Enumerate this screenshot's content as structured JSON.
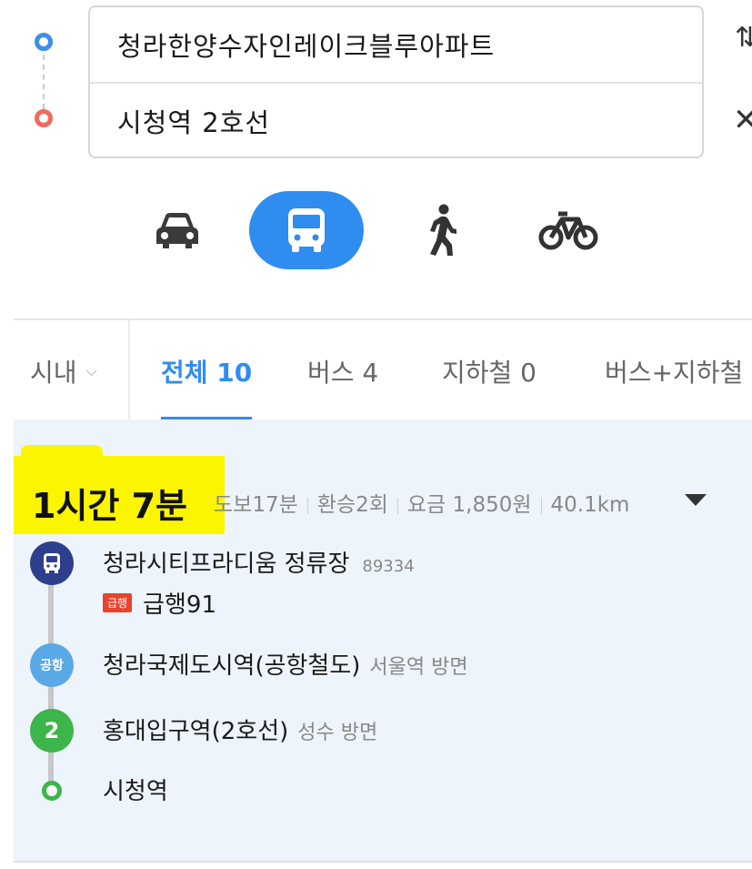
{
  "route": {
    "origin": "청라한양수자인레이크블루아파트",
    "destination": "시청역 2호선"
  },
  "modes": [
    {
      "name": "car",
      "icon": "car-icon",
      "selected": false
    },
    {
      "name": "bus",
      "icon": "bus-icon",
      "selected": true
    },
    {
      "name": "walk",
      "icon": "walk-icon",
      "selected": false
    },
    {
      "name": "bike",
      "icon": "bike-icon",
      "selected": false
    }
  ],
  "tabs": {
    "area": "시내",
    "all": "전체 10",
    "bus": "버스 4",
    "subway": "지하철 0",
    "combo": "버스+지하철"
  },
  "summary": {
    "duration": "1시간 7분",
    "walk": "도보17분",
    "transfers": "환승2회",
    "fare": "요금 1,850원",
    "distance": "40.1km"
  },
  "steps": {
    "s1": {
      "name": "청라시티프라디움 정류장",
      "code": "89334",
      "badge": "급행",
      "bus": "급행91"
    },
    "s2": {
      "icon_label": "공항",
      "name": "청라국제도시역(공항철도)",
      "direction": "서울역 방면"
    },
    "s3": {
      "icon_label": "2",
      "name": "홍대입구역(2호선)",
      "direction": "성수 방면"
    },
    "s4": {
      "name": "시청역"
    }
  },
  "colors": {
    "accent": "#2f8df0",
    "highlight": "#fbf600",
    "bus_stop": "#2c3e8c",
    "airport_line": "#5aa9e6",
    "line2": "#3cb54a",
    "express_badge": "#e8432e",
    "origin_dot": "#3d8ee6",
    "dest_dot": "#ee6b5e"
  }
}
